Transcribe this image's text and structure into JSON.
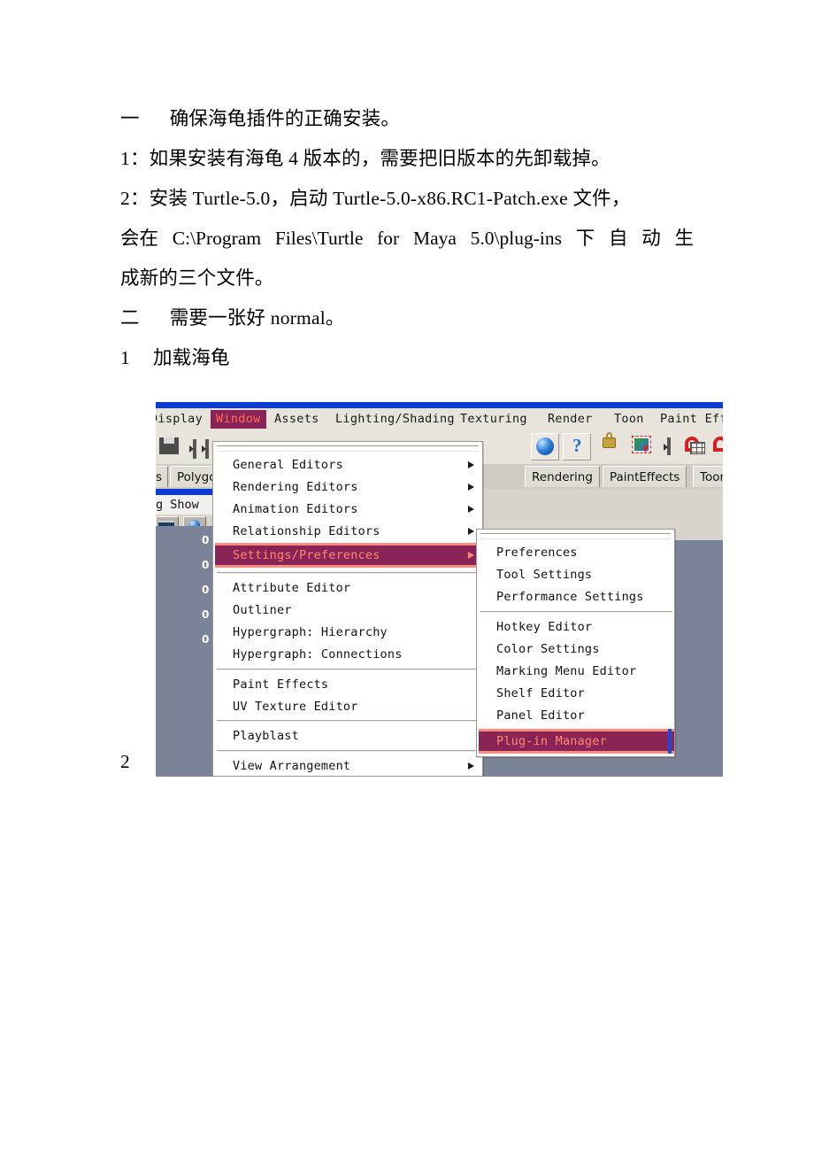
{
  "document": {
    "lines": [
      {
        "id": "l1",
        "index": "一",
        "text": "确保海龟插件的正确安装。"
      },
      {
        "id": "l2",
        "index": "1：",
        "text": "如果安装有海龟 4 版本的，需要把旧版本的先卸载掉。"
      },
      {
        "id": "l3",
        "index": "2：",
        "text": "安装 Turtle-5.0，启动 Turtle-5.0-x86.RC1-Patch.exe 文件，"
      },
      {
        "id": "l4",
        "index": "",
        "text": "会在 C:\\Program Files\\Turtle for Maya 5.0\\plug-ins 下自动生"
      },
      {
        "id": "l5",
        "index": "",
        "text": "成新的三个文件。"
      },
      {
        "id": "l6",
        "index": "二",
        "text": "需要一张好 normal。"
      },
      {
        "id": "l7",
        "index": "1",
        "text": "加载海龟"
      }
    ],
    "line4_segments": [
      "会在",
      "C:\\Program",
      "Files\\Turtle",
      "for",
      "Maya",
      "5.0\\plug-ins",
      "下",
      "自",
      "动",
      "生"
    ],
    "trailing_number": "2"
  },
  "screenshot": {
    "menubar": [
      {
        "label": "Display",
        "active": false
      },
      {
        "label": "Window",
        "active": true
      },
      {
        "label": "Assets",
        "active": false
      },
      {
        "label": "Lighting/Shading",
        "active": false
      },
      {
        "label": "Texturing",
        "active": false
      },
      {
        "label": "Render",
        "active": false
      },
      {
        "label": "Toon",
        "active": false
      },
      {
        "label": "Paint Effe",
        "active": false
      }
    ],
    "toolbar_icons": [
      "save-floppy-icon",
      "slider-handle-icon",
      "slider-handle-icon-2",
      "blue-sphere-icon",
      "help-question-icon",
      "padlock-icon",
      "selection-box-icon",
      "divider-icon",
      "magnet-icon",
      "grid-snap-icon",
      "magnet-icon-2"
    ],
    "shelf_tabs": [
      "s",
      "Polygo",
      "Rendering",
      "PaintEffects",
      "Toon"
    ],
    "panel_menu": "g   Show",
    "viewport_values": [
      "0",
      "0",
      "0",
      "0",
      "0"
    ],
    "window_menu": {
      "items": [
        {
          "label": "General Editors",
          "submenu": true,
          "highlighted": false
        },
        {
          "label": "Rendering Editors",
          "submenu": true,
          "highlighted": false
        },
        {
          "label": "Animation Editors",
          "submenu": true,
          "highlighted": false
        },
        {
          "label": "Relationship Editors",
          "submenu": true,
          "highlighted": false
        },
        {
          "label": "Settings/Preferences",
          "submenu": true,
          "highlighted": true
        },
        {
          "separator": true
        },
        {
          "label": "Attribute Editor",
          "submenu": false,
          "highlighted": false
        },
        {
          "label": "Outliner",
          "submenu": false,
          "highlighted": false
        },
        {
          "label": "Hypergraph: Hierarchy",
          "submenu": false,
          "highlighted": false
        },
        {
          "label": "Hypergraph: Connections",
          "submenu": false,
          "highlighted": false
        },
        {
          "separator": true
        },
        {
          "label": "Paint Effects",
          "submenu": false,
          "highlighted": false
        },
        {
          "label": "UV Texture Editor",
          "submenu": false,
          "highlighted": false
        },
        {
          "separator": true
        },
        {
          "label": "Playblast",
          "submenu": false,
          "highlighted": false
        },
        {
          "separator": true
        },
        {
          "label": "View Arrangement",
          "submenu": true,
          "highlighted": false
        }
      ]
    },
    "submenu": {
      "items": [
        {
          "label": "Preferences",
          "highlighted": false
        },
        {
          "label": "Tool Settings",
          "highlighted": false
        },
        {
          "label": "Performance Settings",
          "highlighted": false
        },
        {
          "separator": true
        },
        {
          "label": "Hotkey Editor",
          "highlighted": false
        },
        {
          "label": "Color Settings",
          "highlighted": false
        },
        {
          "label": "Marking Menu Editor",
          "highlighted": false
        },
        {
          "label": "Shelf Editor",
          "highlighted": false
        },
        {
          "label": "Panel Editor",
          "highlighted": false
        },
        {
          "label": "Plug-in Manager",
          "highlighted": true
        }
      ]
    },
    "colors": {
      "titlebar_blue": "#0A3BD6",
      "menu_highlight_fill": "#8B2456",
      "menu_highlight_border": "#FB8D7E",
      "menu_highlight_text": "#FF8A6E",
      "chrome_beige": "#D8D4CC",
      "viewport_blue_grey": "#7B8399"
    }
  }
}
